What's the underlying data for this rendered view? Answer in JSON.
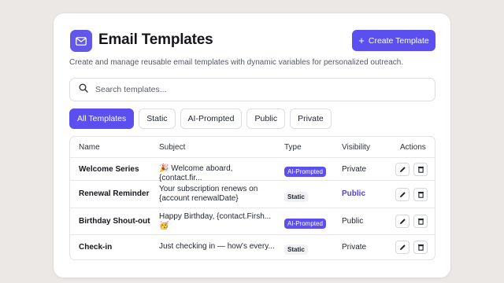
{
  "header": {
    "title": "Email Templates",
    "create_label": "Create Template",
    "subtitle": "Create and manage reusable email templates with dynamic variables for personalized outreach."
  },
  "search": {
    "placeholder": "Search templates..."
  },
  "filters": [
    "All Templates",
    "Static",
    "AI-Prompted",
    "Public",
    "Private"
  ],
  "table": {
    "columns": [
      "Name",
      "Subject",
      "Type",
      "Visibility",
      "Actions"
    ],
    "rows": [
      {
        "name": "Welcome Series",
        "subject": "🎉 Welcome aboard, {contact.fir...",
        "subject2": "",
        "type": "AI-Prompted",
        "visibility": "Private"
      },
      {
        "name": "Renewal Reminder",
        "subject": "Your subscription renews on",
        "subject2": "{account renewalDate}",
        "type": "Static",
        "visibility": "Public"
      },
      {
        "name": "Birthday Shout-out",
        "subject": "Happy Birthday, {contact.Firsh...",
        "subject2": "🥳",
        "type": "AI-Prompted",
        "visibility": "Public"
      },
      {
        "name": "Check-in",
        "subject": "Just checking in — how's every...",
        "subject2": "",
        "type": "Static",
        "visibility": "Private"
      }
    ]
  },
  "colors": {
    "accent": "#5b4ff0",
    "link": "#4b3fe0",
    "background": "#ece8e5"
  },
  "icons": {
    "logo": "mail-icon",
    "search": "search-icon",
    "create": "plus-icon",
    "edit": "pencil-icon",
    "delete": "trash-icon"
  }
}
